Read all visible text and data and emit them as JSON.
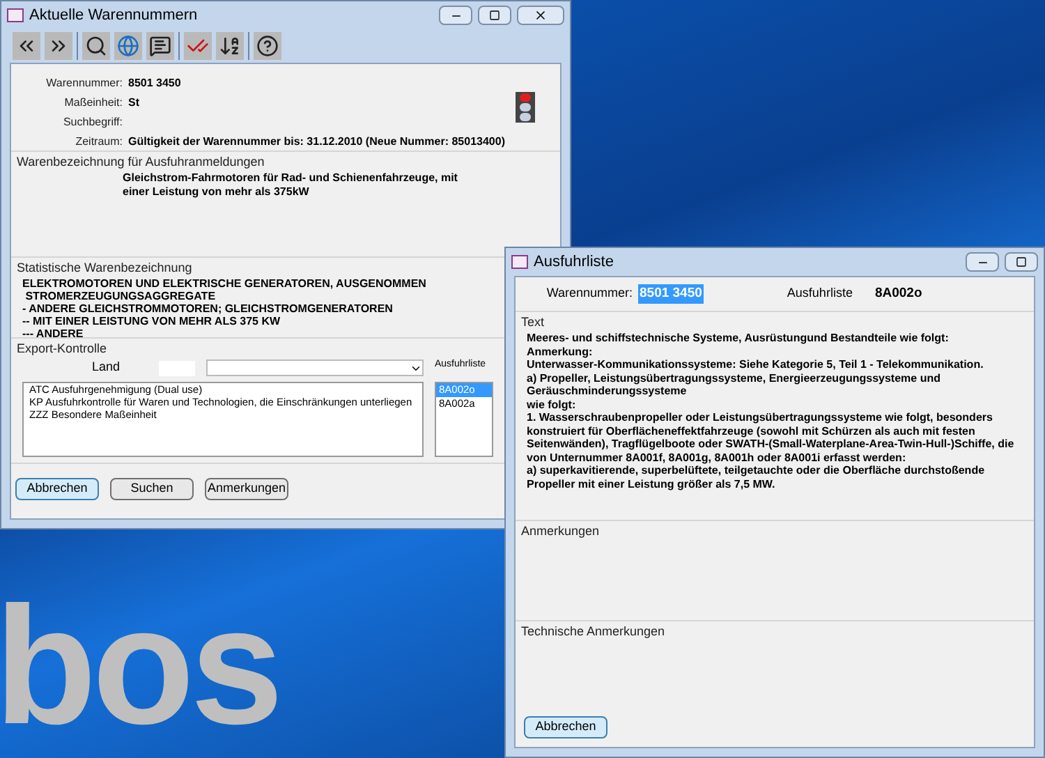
{
  "desktop": {
    "logo_text": "bos"
  },
  "main_window": {
    "title": "Aktuelle Warennummern",
    "toolbar": [
      {
        "kind": "previous"
      },
      {
        "kind": "next"
      },
      {
        "kind": "search"
      },
      {
        "kind": "globe"
      },
      {
        "kind": "notes"
      },
      {
        "kind": "check"
      },
      {
        "kind": "sort"
      },
      {
        "kind": "help"
      }
    ],
    "fields": [
      {
        "label": "Warennummer:",
        "value": "8501 3450"
      },
      {
        "label": "Maßeinheit:",
        "value": "St"
      },
      {
        "label": "Suchbegriff:"
      },
      {
        "label": "Zeitraum:",
        "value": "Gültigkeit der Warennummer bis: 31.12.2010 (Neue Nummer: 85013400)"
      }
    ],
    "description": {
      "title": "Warenbezeichnung für Ausfuhranmeldungen",
      "text": "Gleichstrom-Fahrmotoren für Rad- und Schienenfahrzeuge, mit einer Leistung von mehr als 375kW"
    },
    "statistical": {
      "title": "Statistische Warenbezeichnung",
      "lines": [
        "ELEKTROMOTOREN UND ELEKTRISCHE GENERATOREN, AUSGENOMMEN",
        " STROMERZEUGUNGSAGGREGATE",
        "- ANDERE GLEICHSTROMMOTOREN; GLEICHSTROMGENERATOREN",
        "-- MIT EINER LEISTUNG VON MEHR ALS 375 KW",
        "--- ANDERE"
      ]
    },
    "export_control": {
      "title": "Export-Kontrolle",
      "country_label": "Land",
      "items": [
        {
          "code": "ATC",
          "text": "Ausfuhrgenehmigung (Dual use)"
        },
        {
          "code": "KP",
          "text": "Ausfuhrkontrolle für Waren und Technologien, die Einschränkungen unterliegen"
        },
        {
          "code": "ZZZ",
          "text": "Besondere Maßeinheit"
        }
      ],
      "export_list": {
        "label": "Ausfuhrliste",
        "items": [
          {
            "text": "8A002o",
            "selected": true
          },
          {
            "text": "8A002a",
            "selected": false
          }
        ]
      }
    },
    "buttons": [
      {
        "label": "Abbrechen",
        "default": true
      },
      {
        "label": "Suchen",
        "default": false
      },
      {
        "label": "Anmerkungen",
        "default": false
      }
    ]
  },
  "export_window": {
    "title": "Ausfuhrliste",
    "number_label": "Warennummer:",
    "number_value": "8501 3450",
    "number_selected": true,
    "list_label": "Ausfuhrliste",
    "list_value": "8A002o",
    "text_section": {
      "title": "Text",
      "paragraphs": [
        "Meeres- und schiffstechnische Systeme, Ausrüstungund Bestandteile wie folgt:",
        "Anmerkung:",
        "Unterwasser-Kommunikationssysteme: Siehe Kategorie 5, Teil 1 - Telekommunikation.",
        "a) Propeller, Leistungsübertragungssysteme, Energieerzeugungssysteme und Geräuschminderungssysteme",
        "wie folgt:",
        "1. Wasserschraubenpropeller oder Leistungsübertragungssysteme wie folgt, besonders konstruiert für Oberflächeneffektfahrzeuge (sowohl mit Schürzen als auch mit festen Seitenwänden), Tragflügelboote oder SWATH-(Small-Waterplane-Area-Twin-Hull-)Schiffe, die von Unternummer 8A001f, 8A001g, 8A001h oder 8A001i erfasst werden:",
        "a) superkavitierende, superbelüftete, teilgetauchte oder die Oberfläche durchstoßende Propeller mit einer Leistung größer als 7,5 MW."
      ]
    },
    "notes_title": "Anmerkungen",
    "tech_notes_title": "Technische Anmerkungen",
    "buttons": [
      {
        "label": "Abbrechen",
        "default": true
      }
    ]
  }
}
